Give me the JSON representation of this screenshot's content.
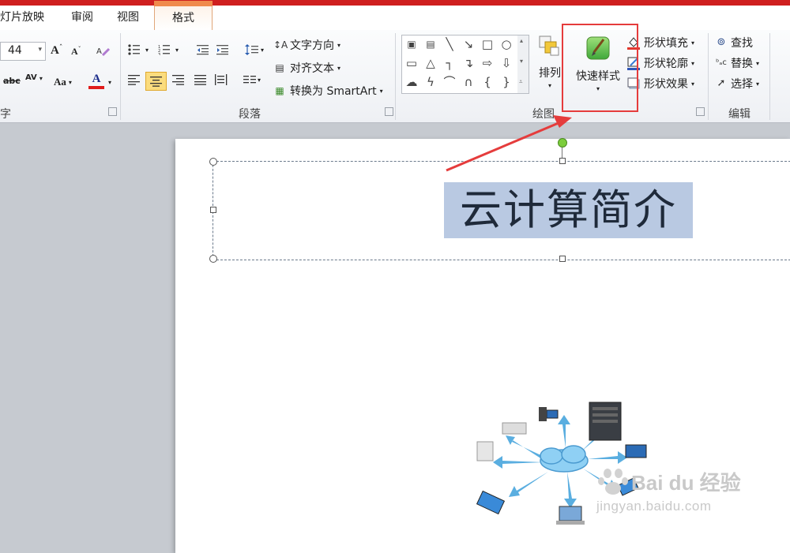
{
  "tabs": {
    "slideshow": "灯片放映",
    "review": "审阅",
    "view": "视图",
    "format": "格式"
  },
  "font_group": {
    "font_size": "44",
    "label": "字体",
    "grow_font": "A",
    "shrink_font": "A",
    "strikethrough": "abc",
    "char_spacing": "AV",
    "change_case": "Aa",
    "font_color_letter": "A",
    "font_color": "#e01b1b"
  },
  "paragraph_group": {
    "text_direction": "文字方向",
    "align_text": "对齐文本",
    "convert_smartart": "转换为 SmartArt",
    "label": "段落"
  },
  "drawing_group": {
    "arrange": "排列",
    "quick_styles": "快速样式",
    "shape_fill": "形状填充",
    "shape_outline": "形状轮廓",
    "shape_effects": "形状效果",
    "label": "绘图"
  },
  "editing_group": {
    "find": "查找",
    "replace": "替换",
    "select": "选择",
    "label": "编辑"
  },
  "slide": {
    "title": "云计算简介"
  },
  "watermark": {
    "logo": "Bai du 经验",
    "url": "jingyan.baidu.com"
  },
  "colors": {
    "accent_red": "#cf1f1f",
    "active_tab_orange": "#f08a4b",
    "annotation_red": "#e53c3c",
    "title_highlight": "#b9c9e2"
  }
}
